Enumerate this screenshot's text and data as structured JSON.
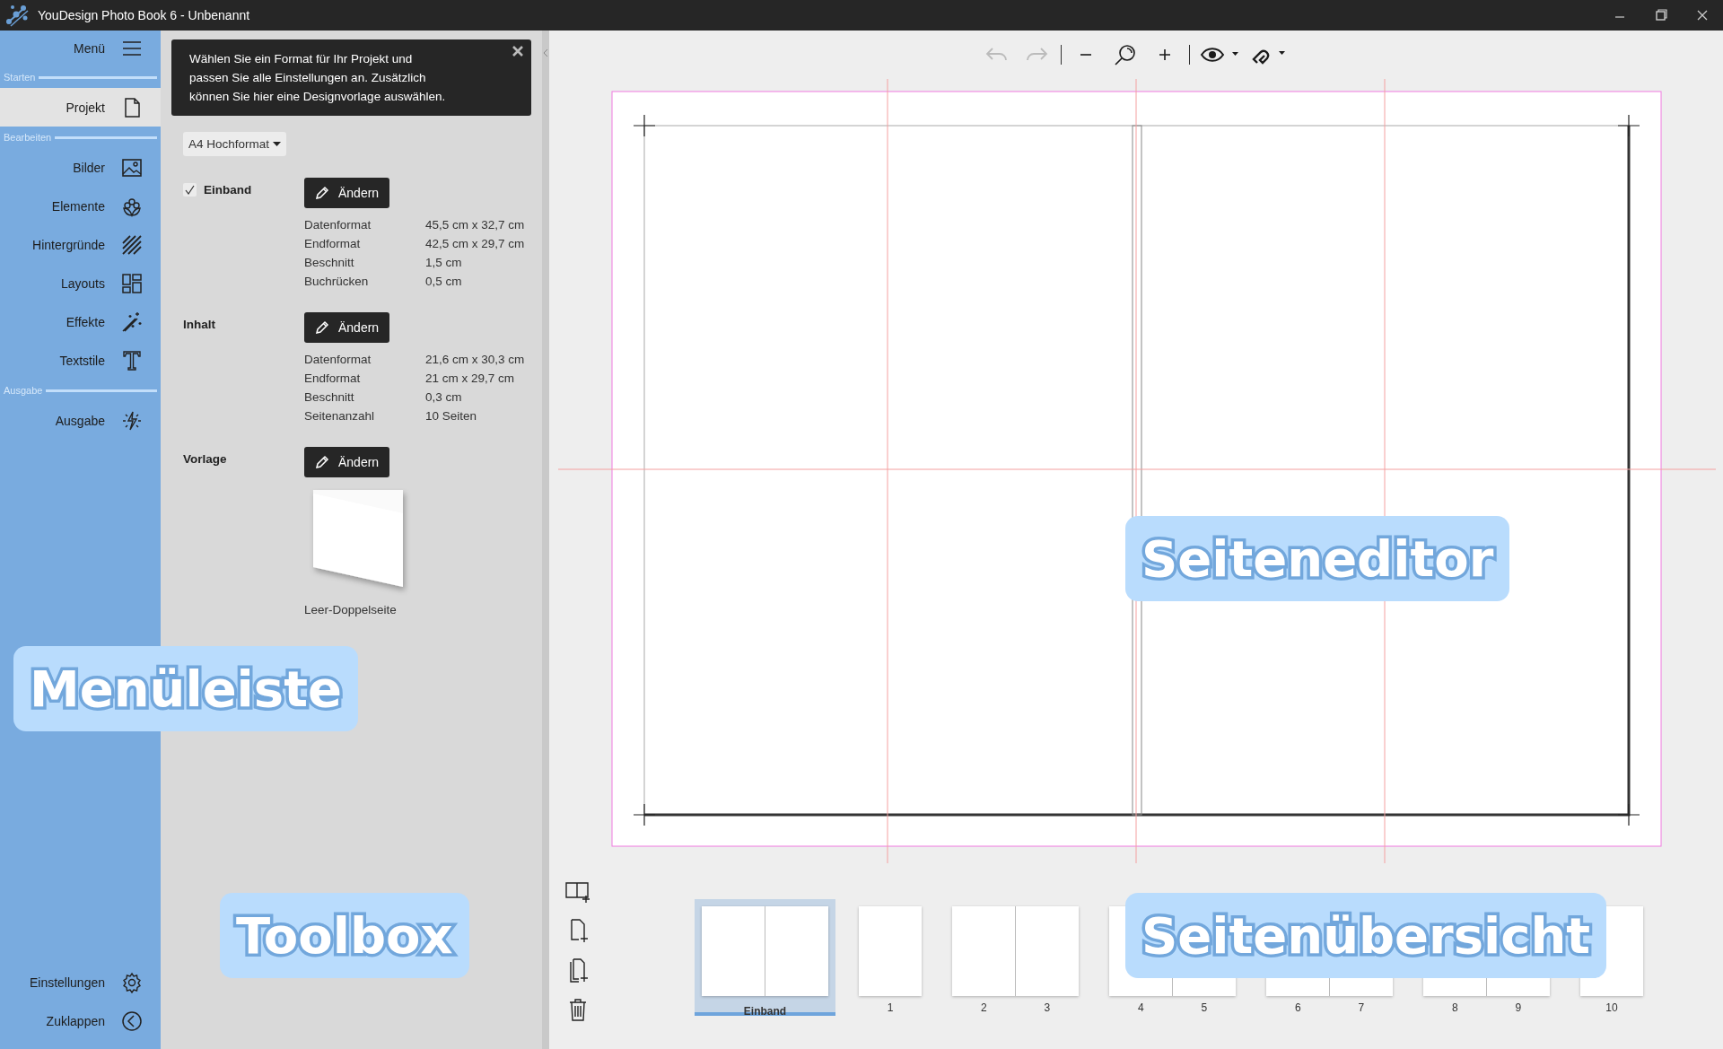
{
  "window": {
    "title": "YouDesign Photo Book 6 - Unbenannt"
  },
  "sidebar": {
    "menu_label": "Menü",
    "sections": [
      {
        "header": "Starten",
        "items": [
          {
            "label": "Projekt",
            "selected": true
          }
        ]
      },
      {
        "header": "Bearbeiten",
        "items": [
          {
            "label": "Bilder",
            "selected": false
          },
          {
            "label": "Elemente",
            "selected": false
          },
          {
            "label": "Hintergründe",
            "selected": false
          },
          {
            "label": "Layouts",
            "selected": false
          },
          {
            "label": "Effekte",
            "selected": false
          },
          {
            "label": "Textstile",
            "selected": false
          }
        ]
      },
      {
        "header": "Ausgabe",
        "items": [
          {
            "label": "Ausgabe",
            "selected": false
          }
        ]
      }
    ],
    "footer_items": [
      {
        "label": "Einstellungen"
      },
      {
        "label": "Zuklappen"
      }
    ]
  },
  "toolbox": {
    "hint": "Wählen Sie ein Format für Ihr Projekt und passen Sie alle Einstellungen an. Zusätzlich können Sie hier eine Designvorlage auswählen.",
    "format": "A4 Hochformat",
    "sections": [
      {
        "kind": "checkbox",
        "title": "Einband",
        "checked": true,
        "button": "Ändern",
        "specs": [
          {
            "label": "Datenformat",
            "value": "45,5 cm x 32,7 cm"
          },
          {
            "label": "Endformat",
            "value": "42,5 cm x 29,7 cm"
          },
          {
            "label": "Beschnitt",
            "value": "1,5 cm"
          },
          {
            "label": "Buchrücken",
            "value": "0,5 cm"
          }
        ]
      },
      {
        "kind": "plain",
        "title": "Inhalt",
        "button": "Ändern",
        "specs": [
          {
            "label": "Datenformat",
            "value": "21,6 cm x 30,3 cm"
          },
          {
            "label": "Endformat",
            "value": "21 cm x 29,7 cm"
          },
          {
            "label": "Beschnitt",
            "value": "0,3 cm"
          },
          {
            "label": "Seitenanzahl",
            "value": "10 Seiten"
          }
        ]
      },
      {
        "kind": "template",
        "title": "Vorlage",
        "button": "Ändern",
        "template_name": "Leer-Doppelseite"
      }
    ]
  },
  "toolbar": [
    {
      "kind": "undo",
      "disabled": true
    },
    {
      "kind": "redo",
      "disabled": true
    },
    {
      "kind": "separator"
    },
    {
      "kind": "zoom-out"
    },
    {
      "kind": "zoom"
    },
    {
      "kind": "zoom-in"
    },
    {
      "kind": "separator"
    },
    {
      "kind": "view"
    },
    {
      "kind": "magnet"
    }
  ],
  "overview": {
    "pages": [
      {
        "kind": "spread",
        "labels": [
          "Einband"
        ],
        "selected": true
      },
      {
        "kind": "single",
        "labels": [
          "1"
        ],
        "selected": false
      },
      {
        "kind": "spread",
        "labels": [
          "2",
          "3"
        ],
        "selected": false
      },
      {
        "kind": "spread",
        "labels": [
          "4",
          "5"
        ],
        "selected": false
      },
      {
        "kind": "spread",
        "labels": [
          "6",
          "7"
        ],
        "selected": false
      },
      {
        "kind": "spread",
        "labels": [
          "8",
          "9"
        ],
        "selected": false
      },
      {
        "kind": "single",
        "labels": [
          "10"
        ],
        "selected": false
      }
    ]
  },
  "callouts": [
    {
      "text": "Menüleiste"
    },
    {
      "text": "Toolbox"
    },
    {
      "text": "Seiteneditor"
    },
    {
      "text": "Seitenübersicht"
    }
  ]
}
